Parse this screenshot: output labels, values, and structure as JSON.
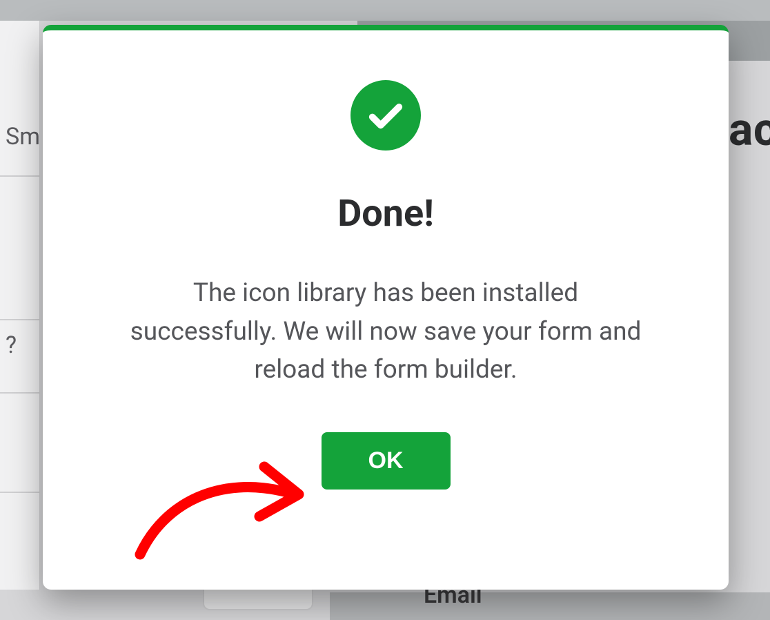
{
  "background": {
    "sidebar_sm": "Sm",
    "sidebar_q": "?",
    "right_title_fragment": "ac",
    "bottom_field_label": "Email"
  },
  "modal": {
    "accent_color": "#14a33a",
    "icon": "check-circle-icon",
    "title": "Done!",
    "message": "The icon library has been installed successfully. We will now save your form and reload the form builder.",
    "ok_label": "OK"
  },
  "annotation": {
    "arrow_color": "#ff0000"
  }
}
